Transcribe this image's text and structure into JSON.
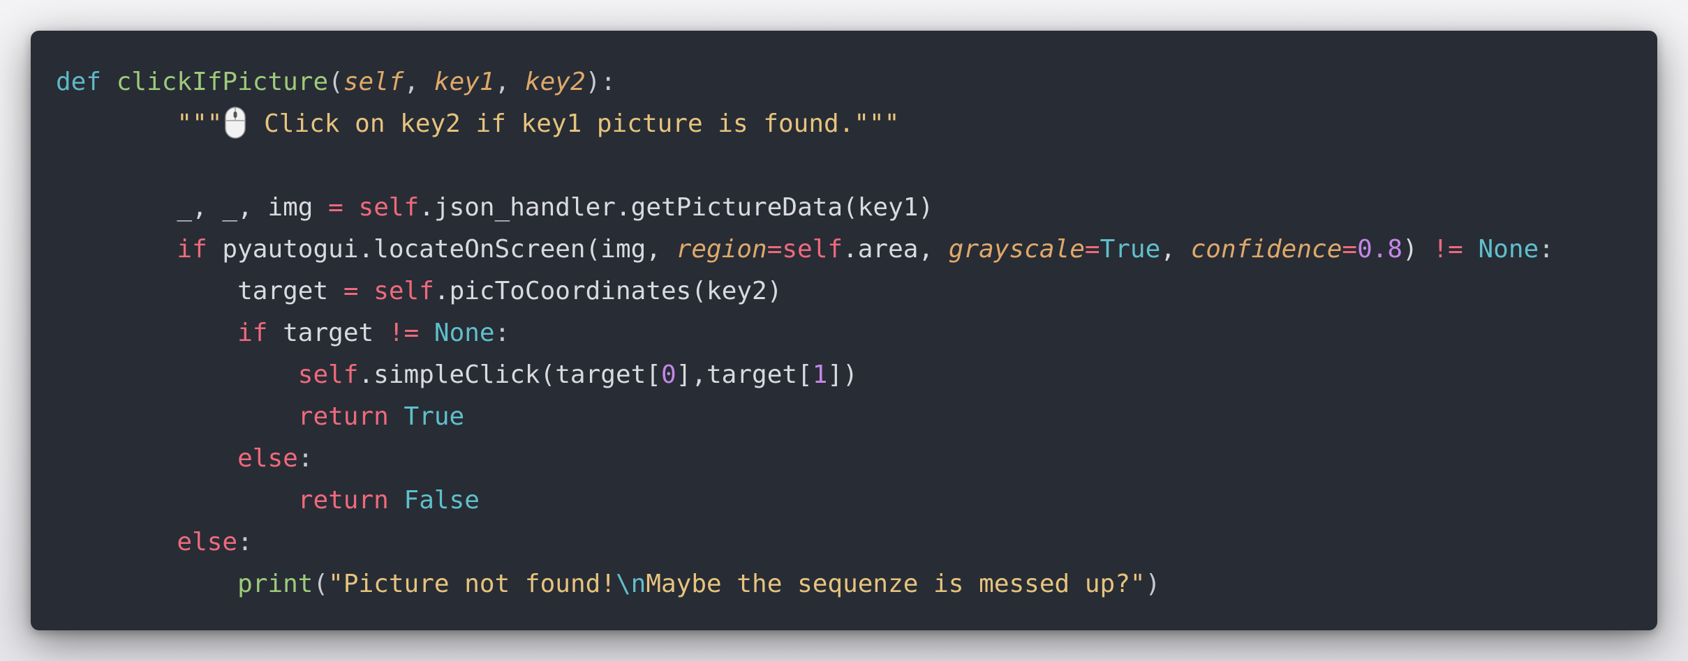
{
  "code": {
    "line1": {
      "kw": "def",
      "name": "clickIfPicture",
      "open": "(",
      "p1": "self",
      "sep1": ", ",
      "p2": "key1",
      "sep2": ", ",
      "p3": "key2",
      "close": "):"
    },
    "line2": {
      "quote_open": "\"\"\"",
      "text": " Click on key2 if key1 picture is found.\"\"\""
    },
    "line4": {
      "a": "_, _, img ",
      "eq": "=",
      "self": "self",
      "rest": ".json_handler.getPictureData(key1)"
    },
    "line5": {
      "kw": "if",
      "a": " pyautogui.locateOnScreen(img, ",
      "region": "region",
      "eq1": "=",
      "self": "self",
      "area": ".area, ",
      "gray": "grayscale",
      "eq2": "=",
      "true": "True",
      "c1": ", ",
      "conf": "confidence",
      "eq3": "=",
      "num": "0.8",
      "c2": ") ",
      "neq": "!=",
      "sp": " ",
      "none": "None",
      "colon": ":"
    },
    "line6": {
      "a": "target ",
      "eq": "=",
      "sp": " ",
      "self": "self",
      "rest": ".picToCoordinates(key2)"
    },
    "line7": {
      "kw": "if",
      "a": " target ",
      "neq": "!=",
      "sp": " ",
      "none": "None",
      "colon": ":"
    },
    "line8": {
      "self": "self",
      "a": ".simpleClick(target[",
      "n0": "0",
      "b": "],target[",
      "n1": "1",
      "c": "])"
    },
    "line9": {
      "kw": "return",
      "sp": " ",
      "val": "True"
    },
    "line10": {
      "kw": "else",
      "colon": ":"
    },
    "line11": {
      "kw": "return",
      "sp": " ",
      "val": "False"
    },
    "line12": {
      "kw": "else",
      "colon": ":"
    },
    "line13": {
      "fn": "print",
      "open": "(",
      "s1": "\"Picture not found!",
      "esc": "\\n",
      "s2": "Maybe the sequenze is messed up?\"",
      "close": ")"
    }
  },
  "icons": {
    "mouse": "computer-mouse-icon"
  },
  "colors": {
    "background": "#282c35",
    "keyword": "#ee6a7c",
    "def": "#5fb8c6",
    "function": "#9dcb7a",
    "param": "#dfa96a",
    "string": "#e6c47c",
    "constant": "#5fbfcb",
    "number": "#c487e6"
  }
}
